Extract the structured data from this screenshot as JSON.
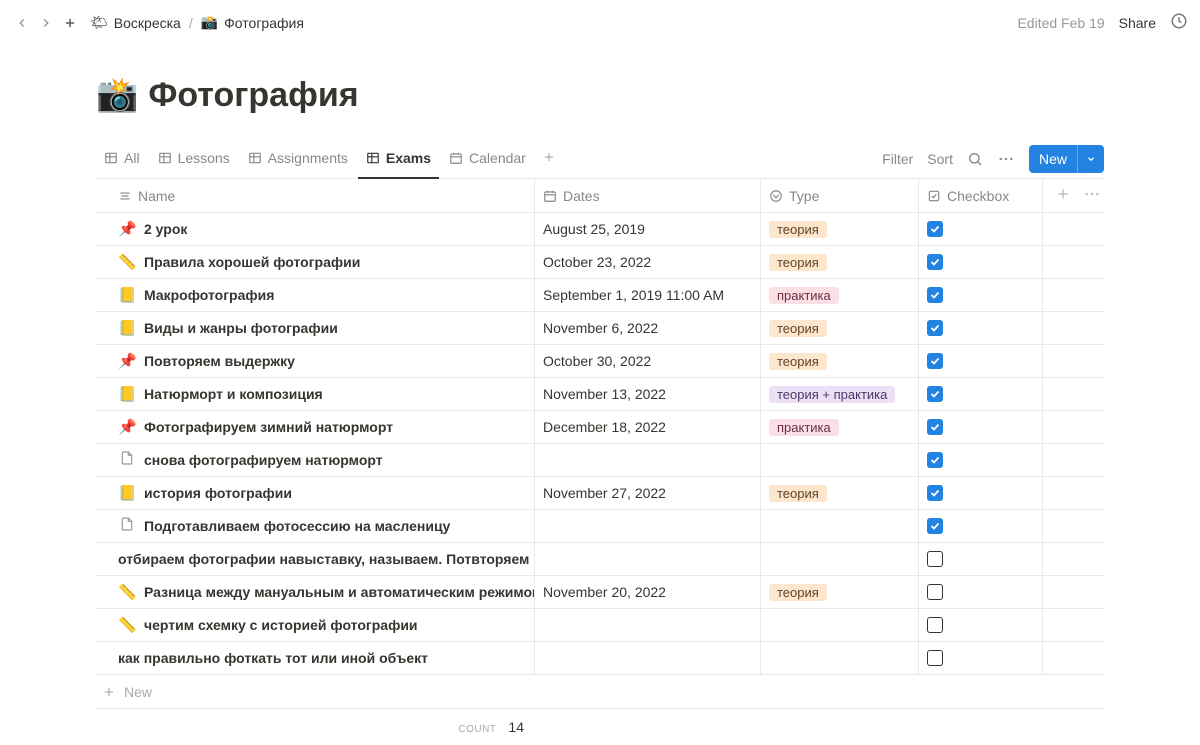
{
  "topbar": {
    "breadcrumb_parent_icon": "🌤",
    "breadcrumb_parent": "Воскреска",
    "breadcrumb_current_icon": "📸",
    "breadcrumb_current": "Фотография",
    "edited": "Edited Feb 19",
    "share": "Share"
  },
  "page": {
    "icon": "📸",
    "title": "Фотография"
  },
  "views": {
    "tabs": [
      {
        "label": "All",
        "active": false
      },
      {
        "label": "Lessons",
        "active": false
      },
      {
        "label": "Assignments",
        "active": false
      },
      {
        "label": "Exams",
        "active": true
      },
      {
        "label": "Calendar",
        "active": false
      }
    ],
    "filter": "Filter",
    "sort": "Sort",
    "new": "New"
  },
  "columns": {
    "name": "Name",
    "dates": "Dates",
    "type": "Type",
    "checkbox": "Checkbox"
  },
  "rows": [
    {
      "emoji": "📌",
      "name": "2 урок",
      "date": "August 25, 2019",
      "type": "теория",
      "typeColor": "orange",
      "checked": true
    },
    {
      "emoji": "📏",
      "name": "Правила хорошей фотографии",
      "date": "October 23, 2022",
      "type": "теория",
      "typeColor": "orange",
      "checked": true
    },
    {
      "emoji": "📒",
      "name": "Макрофотография",
      "date": "September 1, 2019 11:00 AM",
      "type": "практика",
      "typeColor": "pink",
      "checked": true
    },
    {
      "emoji": "📒",
      "name": "Виды и жанры фотографии",
      "date": "November 6, 2022",
      "type": "теория",
      "typeColor": "orange",
      "checked": true
    },
    {
      "emoji": "📌",
      "name": "Повторяем выдержку",
      "date": "October 30, 2022",
      "type": "теория",
      "typeColor": "orange",
      "checked": true
    },
    {
      "emoji": "📒",
      "name": "Натюрморт и композиция",
      "date": "November 13, 2022",
      "type": "теория + практика",
      "typeColor": "purple",
      "checked": true
    },
    {
      "emoji": "📌",
      "name": "Фотографируем зимний натюрморт",
      "date": "December 18, 2022",
      "type": "практика",
      "typeColor": "pink",
      "checked": true
    },
    {
      "emoji": "📄",
      "name": "снова фотографируем натюрморт",
      "date": "",
      "type": "",
      "typeColor": "",
      "checked": true
    },
    {
      "emoji": "📒",
      "name": "история фотографии",
      "date": "November 27, 2022",
      "type": "теория",
      "typeColor": "orange",
      "checked": true
    },
    {
      "emoji": "📄",
      "name": "Подготавливаем фотосессию на масленицу",
      "date": "",
      "type": "",
      "typeColor": "",
      "checked": true
    },
    {
      "emoji": "",
      "name": "отбираем фотографии навыставку, называем. Потвторяем исто",
      "date": "",
      "type": "",
      "typeColor": "",
      "checked": false
    },
    {
      "emoji": "📏",
      "name": "Разница между мануальным и автоматическим режимом",
      "date": "November 20, 2022",
      "type": "теория",
      "typeColor": "orange",
      "checked": false
    },
    {
      "emoji": "📏",
      "name": "чертим схемку с историей фотографии",
      "date": "",
      "type": "",
      "typeColor": "",
      "checked": false
    },
    {
      "emoji": "",
      "name": "как правильно фоткать тот или иной объект",
      "date": "",
      "type": "",
      "typeColor": "",
      "checked": false
    }
  ],
  "footer": {
    "new": "New",
    "count_label": "COUNT",
    "count_value": "14"
  }
}
